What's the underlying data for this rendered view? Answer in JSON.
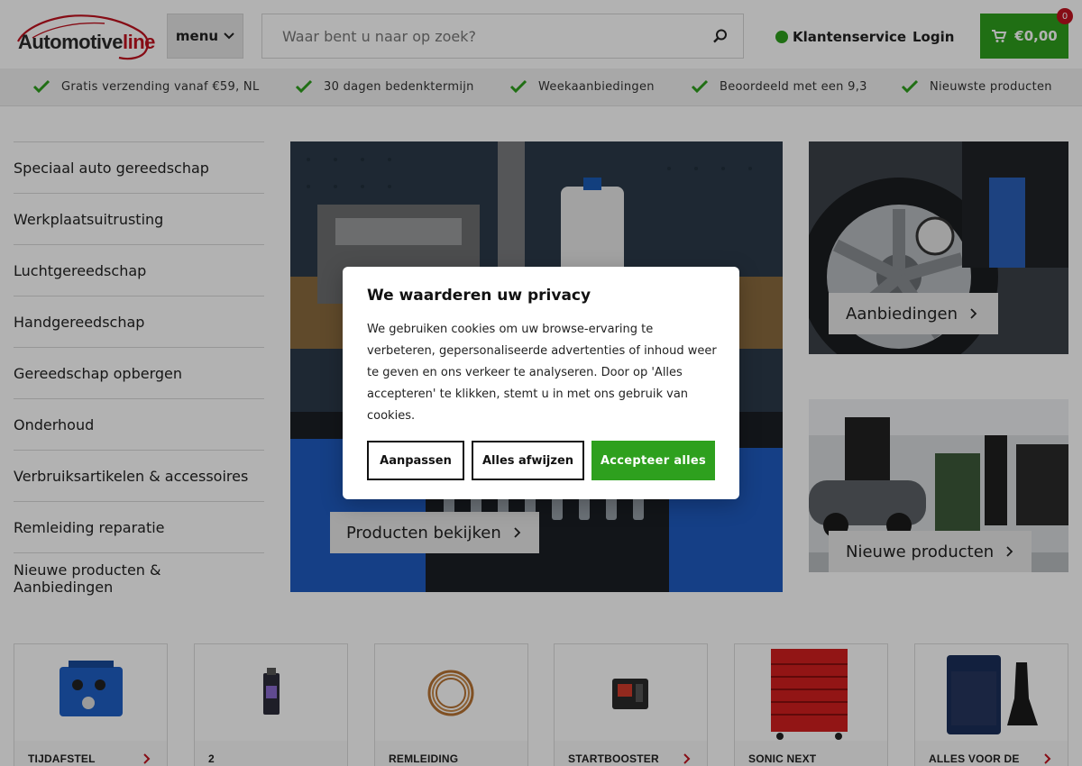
{
  "brand": {
    "logo_text_a": "Automotive",
    "logo_text_b": "line"
  },
  "header": {
    "menu_label": "menu",
    "search_placeholder": "Waar bent u naar op zoek?",
    "service_label": "Klantenservice",
    "login_label": "Login",
    "cart_total": "€0,00",
    "cart_count": "0"
  },
  "usps": [
    "Gratis verzending vanaf €59, NL",
    "30 dagen bedenktermijn",
    "Weekaanbiedingen",
    "Beoordeeld met een 9,3",
    "Nieuwste producten"
  ],
  "categories": [
    "Speciaal auto gereedschap",
    "Werkplaatsuitrusting",
    "Luchtgereedschap",
    "Handgereedschap",
    "Gereedschap opbergen",
    "Onderhoud",
    "Verbruiksartikelen & accessoires",
    "Remleiding reparatie",
    "Nieuwe producten & Aanbiedingen"
  ],
  "hero": {
    "cta_label": "Producten bekijken"
  },
  "tiles": {
    "offers_label": "Aanbiedingen",
    "new_label": "Nieuwe producten"
  },
  "cards": [
    "TIJDAFSTEL",
    "2",
    "REMLEIDING",
    "STARTBOOSTER",
    "SONIC NEXT",
    "ALLES VOOR DE"
  ],
  "cookie": {
    "title": "We waarderen uw privacy",
    "body": "We gebruiken cookies om uw browse-ervaring te verbeteren, gepersonaliseerde advertenties of inhoud weer te geven en ons verkeer te analyseren. Door op 'Alles accepteren' te klikken, stemt u in met ons gebruik van cookies.",
    "customize_label": "Aanpassen",
    "reject_label": "Alles afwijzen",
    "accept_label": "Accepteer alles"
  },
  "colors": {
    "accent_green": "#2ea01e",
    "brand_red": "#c1121f"
  }
}
